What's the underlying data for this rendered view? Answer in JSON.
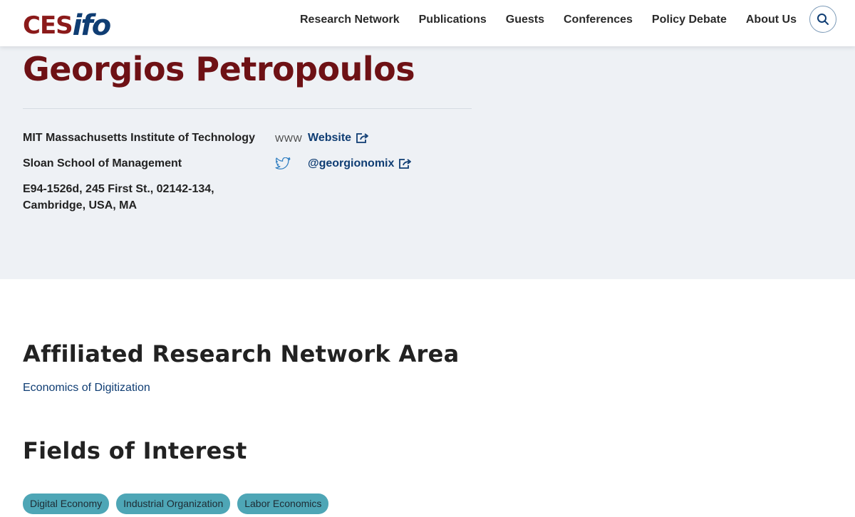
{
  "header": {
    "logo": {
      "ces": "CES",
      "ifo": "ifo"
    },
    "nav": [
      {
        "label": "Research Network"
      },
      {
        "label": "Publications"
      },
      {
        "label": "Guests"
      },
      {
        "label": "Conferences"
      },
      {
        "label": "Policy Debate"
      },
      {
        "label": "About Us"
      }
    ],
    "search_icon": "search-icon"
  },
  "profile": {
    "name": "Georgios Petropoulos",
    "institution": "MIT Massachusetts Institute of Technology",
    "school": "Sloan School of Management",
    "address_line1": "E94-1526d, 245 First St., 02142-134,",
    "address_line2": "Cambridge, USA, MA",
    "website": {
      "prefix": "WWW",
      "label": "Website",
      "icon": "external-link-icon"
    },
    "twitter": {
      "icon": "twitter-icon",
      "label": "@georgionomix",
      "link_icon": "external-link-icon"
    }
  },
  "affiliated": {
    "heading": "Affiliated Research Network Area",
    "area": "Economics of Digitization"
  },
  "fields": {
    "heading": "Fields of Interest",
    "tags": [
      {
        "label": "Digital Economy"
      },
      {
        "label": "Industrial Organization"
      },
      {
        "label": "Labor Economics"
      }
    ]
  },
  "colors": {
    "brand_red": "#8b1a1a",
    "brand_blue": "#0f3d73",
    "profile_bg": "#eef1f5",
    "tag_bg": "#4ea6b6"
  }
}
